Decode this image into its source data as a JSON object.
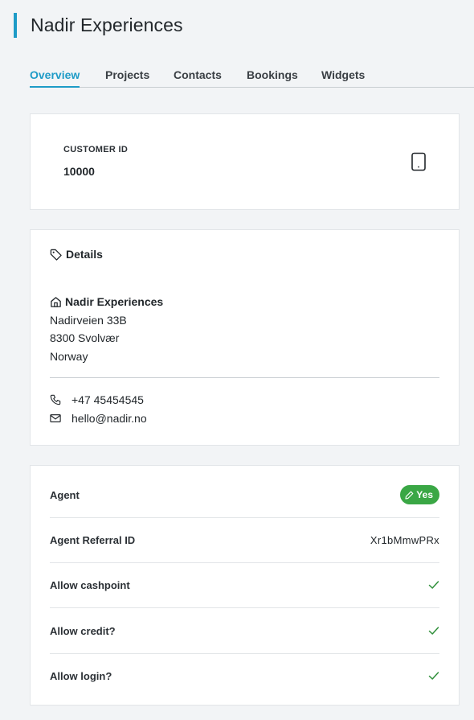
{
  "page": {
    "title": "Nadir Experiences"
  },
  "tabs": [
    {
      "label": "Overview",
      "active": true
    },
    {
      "label": "Projects",
      "active": false
    },
    {
      "label": "Contacts",
      "active": false
    },
    {
      "label": "Bookings",
      "active": false
    },
    {
      "label": "Widgets",
      "active": false
    }
  ],
  "customer": {
    "id_label": "CUSTOMER ID",
    "id_value": "10000",
    "icon": "tablet-icon"
  },
  "details": {
    "heading": "Details",
    "company": "Nadir Experiences",
    "address_line1": "Nadirveien 33B",
    "address_line2": "8300 Svolvær",
    "country": "Norway",
    "phone": "+47 45454545",
    "email": "hello@nadir.no"
  },
  "properties": [
    {
      "label": "Agent",
      "type": "badge",
      "value": "Yes"
    },
    {
      "label": "Agent Referral ID",
      "type": "text",
      "value": "Xr1bMmwPRx"
    },
    {
      "label": "Allow cashpoint",
      "type": "check",
      "value": true
    },
    {
      "label": "Allow credit?",
      "type": "check",
      "value": true
    },
    {
      "label": "Allow login?",
      "type": "check",
      "value": true
    }
  ],
  "colors": {
    "accent": "#1e9bc7",
    "success": "#3aa745",
    "check": "#2f8f3a"
  }
}
